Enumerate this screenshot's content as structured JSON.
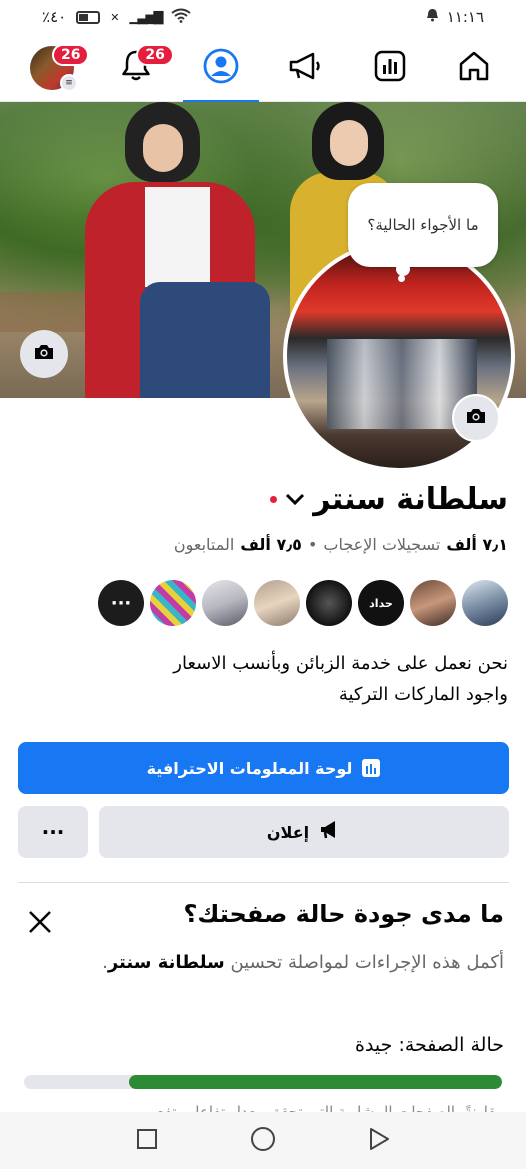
{
  "status_bar": {
    "battery": "٪٤٠",
    "time": "١١:١٦"
  },
  "nav": {
    "profile_badge": "26",
    "notifications_badge": "26",
    "icons": [
      "avatar",
      "bell-icon",
      "profile-circle-icon",
      "megaphone-icon",
      "insights-icon",
      "home-icon"
    ],
    "active_tab": "profile",
    "accent_color": "#1877f2"
  },
  "cover": {
    "bubble_text": "ما الأجواء الحالية؟"
  },
  "page": {
    "name": "سلطانة سنتر",
    "likes_count": "٧٫١ ألف",
    "likes_label": "تسجيلات الإعجاب",
    "followers_count": "٧٫٥ ألف",
    "followers_label": "المتابعون",
    "separator": "•",
    "friend_text_tile": "حداد",
    "bio_line1": "نحن نعمل على خدمة الزبائن وبأنسب الاسعار",
    "bio_line2": "واجود الماركات التركية"
  },
  "actions": {
    "dashboard_label": "لوحة المعلومات الاحترافية",
    "ad_label": "إعلان",
    "more_label": "···"
  },
  "quality": {
    "title": "ما مدى جودة حالة صفحتك؟",
    "desc_prefix": "أكمل هذه الإجراءات لمواصلة تحسين",
    "desc_name": "سلطانة سنتر",
    "desc_suffix": ".",
    "status_label": "حالة الصفحة:",
    "status_value": "جيدة",
    "progress": 0.78,
    "progress_color": "#2e8b35",
    "cut_text": "مقارنةً بالصفحات المشابهة التي تحقق معدل تفاعل وتفع"
  }
}
